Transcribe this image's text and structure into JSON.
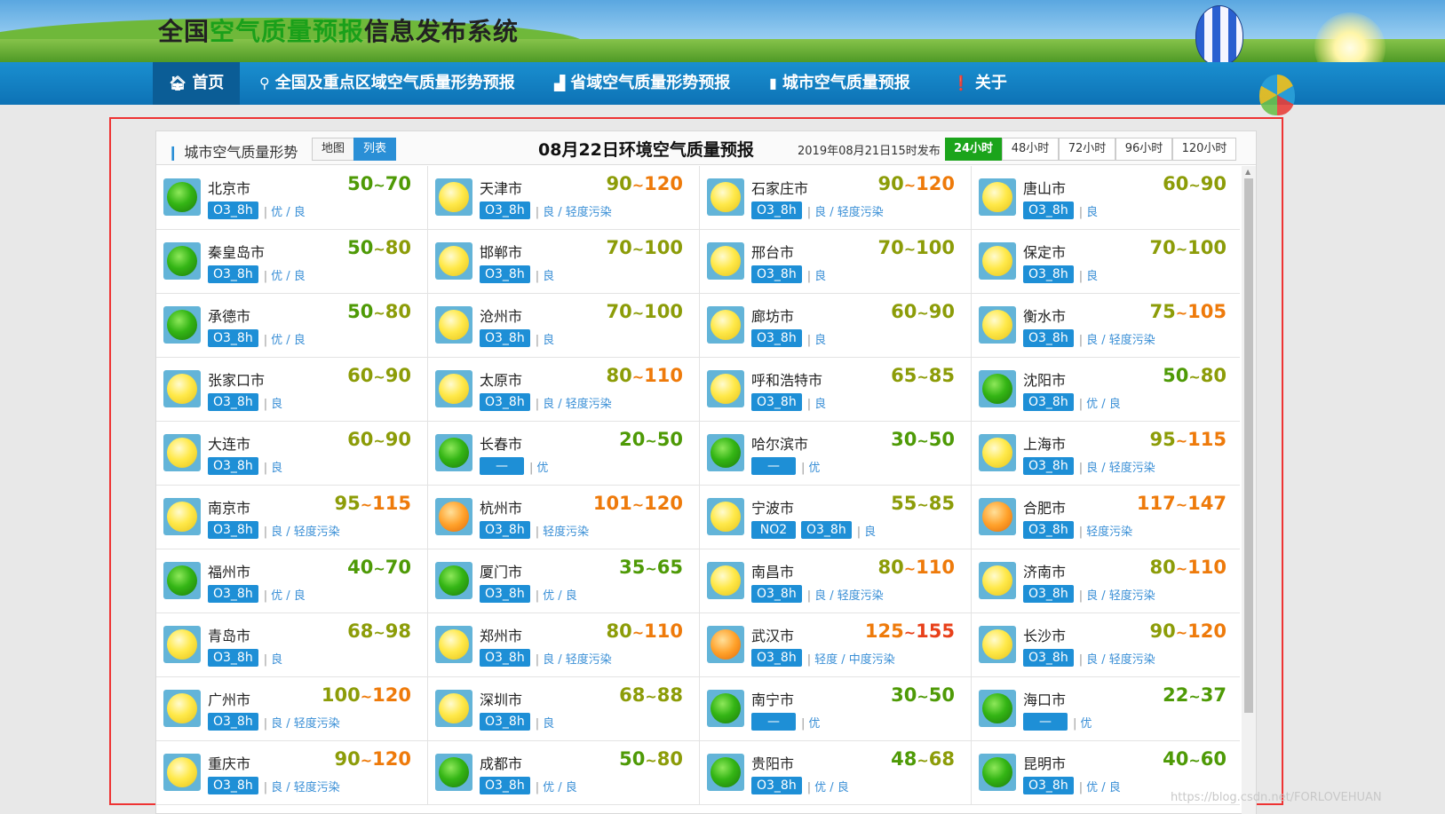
{
  "site": {
    "title_prefix": "全国",
    "title_highlight": "空气质量预报",
    "title_suffix": "信息发布系统"
  },
  "nav": {
    "items": [
      {
        "label": "首页",
        "icon": "home-icon",
        "glyph": "🏠︎"
      },
      {
        "label": "全国及重点区域空气质量形势预报",
        "icon": "map-pin-icon",
        "glyph": "⚲"
      },
      {
        "label": "省域空气质量形势预报",
        "icon": "area-chart-icon",
        "glyph": "▟"
      },
      {
        "label": "城市空气质量预报",
        "icon": "bar-chart-icon",
        "glyph": "▮"
      },
      {
        "label": "关于",
        "icon": "info-icon",
        "glyph": "❗"
      }
    ]
  },
  "panel": {
    "trend_label": "城市空气质量形势",
    "view_map": "地图",
    "view_list": "列表",
    "forecast_title": "08月22日环境空气质量预报",
    "publish_time": "2019年08月21日15时发布",
    "hour_tabs": [
      "24小时",
      "48小时",
      "72小时",
      "96小时",
      "120小时"
    ]
  },
  "colors": {
    "green": "#4e9a06",
    "olive": "#8c9c08",
    "orange": "#ee7a0a",
    "red": "#e8401a",
    "tag_blue": "#1e8fd6",
    "active_tab": "#1ba41b"
  },
  "cities": [
    {
      "name": "北京市",
      "low": "50",
      "high": "70",
      "ball": "green",
      "low_color": "green",
      "high_color": "green",
      "tags": [
        "O3_8h"
      ],
      "level": "优 / 良"
    },
    {
      "name": "天津市",
      "low": "90",
      "high": "120",
      "ball": "yellow",
      "low_color": "olive",
      "high_color": "orange",
      "tags": [
        "O3_8h"
      ],
      "level": "良 / 轻度污染"
    },
    {
      "name": "石家庄市",
      "low": "90",
      "high": "120",
      "ball": "yellow",
      "low_color": "olive",
      "high_color": "orange",
      "tags": [
        "O3_8h"
      ],
      "level": "良 / 轻度污染"
    },
    {
      "name": "唐山市",
      "low": "60",
      "high": "90",
      "ball": "yellow",
      "low_color": "olive",
      "high_color": "olive",
      "tags": [
        "O3_8h"
      ],
      "level": "良"
    },
    {
      "name": "秦皇岛市",
      "low": "50",
      "high": "80",
      "ball": "green",
      "low_color": "green",
      "high_color": "olive",
      "tags": [
        "O3_8h"
      ],
      "level": "优 / 良"
    },
    {
      "name": "邯郸市",
      "low": "70",
      "high": "100",
      "ball": "yellow",
      "low_color": "olive",
      "high_color": "olive",
      "tags": [
        "O3_8h"
      ],
      "level": "良"
    },
    {
      "name": "邢台市",
      "low": "70",
      "high": "100",
      "ball": "yellow",
      "low_color": "olive",
      "high_color": "olive",
      "tags": [
        "O3_8h"
      ],
      "level": "良"
    },
    {
      "name": "保定市",
      "low": "70",
      "high": "100",
      "ball": "yellow",
      "low_color": "olive",
      "high_color": "olive",
      "tags": [
        "O3_8h"
      ],
      "level": "良"
    },
    {
      "name": "承德市",
      "low": "50",
      "high": "80",
      "ball": "green",
      "low_color": "green",
      "high_color": "olive",
      "tags": [
        "O3_8h"
      ],
      "level": "优 / 良"
    },
    {
      "name": "沧州市",
      "low": "70",
      "high": "100",
      "ball": "yellow",
      "low_color": "olive",
      "high_color": "olive",
      "tags": [
        "O3_8h"
      ],
      "level": "良"
    },
    {
      "name": "廊坊市",
      "low": "60",
      "high": "90",
      "ball": "yellow",
      "low_color": "olive",
      "high_color": "olive",
      "tags": [
        "O3_8h"
      ],
      "level": "良"
    },
    {
      "name": "衡水市",
      "low": "75",
      "high": "105",
      "ball": "yellow",
      "low_color": "olive",
      "high_color": "orange",
      "tags": [
        "O3_8h"
      ],
      "level": "良 / 轻度污染"
    },
    {
      "name": "张家口市",
      "low": "60",
      "high": "90",
      "ball": "yellow",
      "low_color": "olive",
      "high_color": "olive",
      "tags": [
        "O3_8h"
      ],
      "level": "良"
    },
    {
      "name": "太原市",
      "low": "80",
      "high": "110",
      "ball": "yellow",
      "low_color": "olive",
      "high_color": "orange",
      "tags": [
        "O3_8h"
      ],
      "level": "良 / 轻度污染"
    },
    {
      "name": "呼和浩特市",
      "low": "65",
      "high": "85",
      "ball": "yellow",
      "low_color": "olive",
      "high_color": "olive",
      "tags": [
        "O3_8h"
      ],
      "level": "良"
    },
    {
      "name": "沈阳市",
      "low": "50",
      "high": "80",
      "ball": "green",
      "low_color": "green",
      "high_color": "olive",
      "tags": [
        "O3_8h"
      ],
      "level": "优 / 良"
    },
    {
      "name": "大连市",
      "low": "60",
      "high": "90",
      "ball": "yellow",
      "low_color": "olive",
      "high_color": "olive",
      "tags": [
        "O3_8h"
      ],
      "level": "良"
    },
    {
      "name": "长春市",
      "low": "20",
      "high": "50",
      "ball": "green",
      "low_color": "green",
      "high_color": "green",
      "tags": [
        "—"
      ],
      "level": "优"
    },
    {
      "name": "哈尔滨市",
      "low": "30",
      "high": "50",
      "ball": "green",
      "low_color": "green",
      "high_color": "green",
      "tags": [
        "—"
      ],
      "level": "优"
    },
    {
      "name": "上海市",
      "low": "95",
      "high": "115",
      "ball": "yellow",
      "low_color": "olive",
      "high_color": "orange",
      "tags": [
        "O3_8h"
      ],
      "level": "良 / 轻度污染"
    },
    {
      "name": "南京市",
      "low": "95",
      "high": "115",
      "ball": "yellow",
      "low_color": "olive",
      "high_color": "orange",
      "tags": [
        "O3_8h"
      ],
      "level": "良 / 轻度污染"
    },
    {
      "name": "杭州市",
      "low": "101",
      "high": "120",
      "ball": "orange",
      "low_color": "orange",
      "high_color": "orange",
      "tags": [
        "O3_8h"
      ],
      "level": "轻度污染"
    },
    {
      "name": "宁波市",
      "low": "55",
      "high": "85",
      "ball": "yellow",
      "low_color": "olive",
      "high_color": "olive",
      "tags": [
        "NO2",
        "O3_8h"
      ],
      "level": "良"
    },
    {
      "name": "合肥市",
      "low": "117",
      "high": "147",
      "ball": "orange",
      "low_color": "orange",
      "high_color": "orange",
      "tags": [
        "O3_8h"
      ],
      "level": "轻度污染"
    },
    {
      "name": "福州市",
      "low": "40",
      "high": "70",
      "ball": "green",
      "low_color": "green",
      "high_color": "green",
      "tags": [
        "O3_8h"
      ],
      "level": "优 / 良"
    },
    {
      "name": "厦门市",
      "low": "35",
      "high": "65",
      "ball": "green",
      "low_color": "green",
      "high_color": "green",
      "tags": [
        "O3_8h"
      ],
      "level": "优 / 良"
    },
    {
      "name": "南昌市",
      "low": "80",
      "high": "110",
      "ball": "yellow",
      "low_color": "olive",
      "high_color": "orange",
      "tags": [
        "O3_8h"
      ],
      "level": "良 / 轻度污染"
    },
    {
      "name": "济南市",
      "low": "80",
      "high": "110",
      "ball": "yellow",
      "low_color": "olive",
      "high_color": "orange",
      "tags": [
        "O3_8h"
      ],
      "level": "良 / 轻度污染"
    },
    {
      "name": "青岛市",
      "low": "68",
      "high": "98",
      "ball": "yellow",
      "low_color": "olive",
      "high_color": "olive",
      "tags": [
        "O3_8h"
      ],
      "level": "良"
    },
    {
      "name": "郑州市",
      "low": "80",
      "high": "110",
      "ball": "yellow",
      "low_color": "olive",
      "high_color": "orange",
      "tags": [
        "O3_8h"
      ],
      "level": "良 / 轻度污染"
    },
    {
      "name": "武汉市",
      "low": "125",
      "high": "155",
      "ball": "orange",
      "low_color": "orange",
      "high_color": "red",
      "tags": [
        "O3_8h"
      ],
      "level": "轻度 / 中度污染"
    },
    {
      "name": "长沙市",
      "low": "90",
      "high": "120",
      "ball": "yellow",
      "low_color": "olive",
      "high_color": "orange",
      "tags": [
        "O3_8h"
      ],
      "level": "良 / 轻度污染"
    },
    {
      "name": "广州市",
      "low": "100",
      "high": "120",
      "ball": "yellow",
      "low_color": "olive",
      "high_color": "orange",
      "tags": [
        "O3_8h"
      ],
      "level": "良 / 轻度污染"
    },
    {
      "name": "深圳市",
      "low": "68",
      "high": "88",
      "ball": "yellow",
      "low_color": "olive",
      "high_color": "olive",
      "tags": [
        "O3_8h"
      ],
      "level": "良"
    },
    {
      "name": "南宁市",
      "low": "30",
      "high": "50",
      "ball": "green",
      "low_color": "green",
      "high_color": "green",
      "tags": [
        "—"
      ],
      "level": "优"
    },
    {
      "name": "海口市",
      "low": "22",
      "high": "37",
      "ball": "green",
      "low_color": "green",
      "high_color": "green",
      "tags": [
        "—"
      ],
      "level": "优"
    },
    {
      "name": "重庆市",
      "low": "90",
      "high": "120",
      "ball": "yellow",
      "low_color": "olive",
      "high_color": "orange",
      "tags": [
        "O3_8h"
      ],
      "level": "良 / 轻度污染"
    },
    {
      "name": "成都市",
      "low": "50",
      "high": "80",
      "ball": "green",
      "low_color": "green",
      "high_color": "olive",
      "tags": [
        "O3_8h"
      ],
      "level": "优 / 良"
    },
    {
      "name": "贵阳市",
      "low": "48",
      "high": "68",
      "ball": "green",
      "low_color": "green",
      "high_color": "olive",
      "tags": [
        "O3_8h"
      ],
      "level": "优 / 良"
    },
    {
      "name": "昆明市",
      "low": "40",
      "high": "60",
      "ball": "green",
      "low_color": "green",
      "high_color": "green",
      "tags": [
        "O3_8h"
      ],
      "level": "优 / 良"
    }
  ],
  "watermark": "https://blog.csdn.net/FORLOVEHUAN"
}
